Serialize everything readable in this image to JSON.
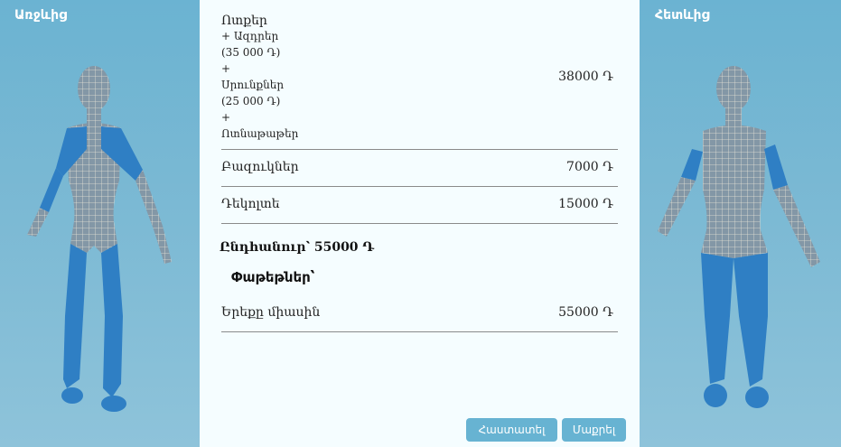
{
  "left_panel": {
    "title": "Առջևից"
  },
  "right_panel": {
    "title": "Հետևից"
  },
  "items": [
    {
      "label": "Ոտքեր",
      "lines": [
        "+ Ազդրեր",
        "(35 000 Դ)",
        "+",
        "Սրունքներ",
        "(25 000 Դ)",
        "+",
        "Ոտնաթաթեր"
      ],
      "price": "38000 Դ"
    },
    {
      "label": "Բազուկներ",
      "price": "7000 Դ"
    },
    {
      "label": "Դեկոլտե",
      "price": "15000 Դ"
    }
  ],
  "total": "Ընդհանուր՝ 55000 Դ",
  "packages": {
    "title": "Փաթեթներ՝",
    "items": [
      {
        "label": "Երեքը միասին",
        "price": "55000 Դ"
      }
    ]
  },
  "buttons": {
    "confirm": "Հաստատել",
    "cancel": "Մաքրել"
  }
}
